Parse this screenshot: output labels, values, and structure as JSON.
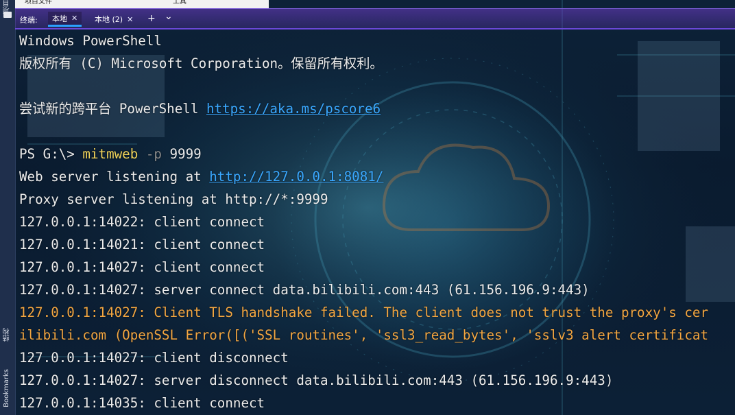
{
  "top_menu": {
    "items": [
      "项目文件",
      "工具"
    ]
  },
  "left_strip": {
    "top_label": "项目",
    "mid_label": "结构",
    "bottom_label": "Bookmarks"
  },
  "tabs": {
    "section_label": "终端:",
    "items": [
      {
        "label": "本地",
        "active": true
      },
      {
        "label": "本地 (2)",
        "active": false
      }
    ],
    "add_icon": "+",
    "dropdown_icon": "⌄"
  },
  "terminal": {
    "lines": [
      {
        "segments": [
          {
            "text": "Windows PowerShell",
            "style": "normal"
          }
        ]
      },
      {
        "segments": [
          {
            "text": "版权所有 (C) Microsoft Corporation。保留所有权利。",
            "style": "normal"
          }
        ]
      },
      {
        "segments": [
          {
            "text": "",
            "style": "normal"
          }
        ]
      },
      {
        "segments": [
          {
            "text": "尝试新的跨平台 PowerShell ",
            "style": "normal"
          },
          {
            "text": "https://aka.ms/pscore6",
            "style": "link"
          }
        ]
      },
      {
        "segments": [
          {
            "text": "",
            "style": "normal"
          }
        ]
      },
      {
        "segments": [
          {
            "text": "PS G:\\> ",
            "style": "normal"
          },
          {
            "text": "mitmweb",
            "style": "cmd"
          },
          {
            "text": " -p",
            "style": "flag"
          },
          {
            "text": " 9999",
            "style": "normal"
          }
        ]
      },
      {
        "segments": [
          {
            "text": "Web server listening at ",
            "style": "normal"
          },
          {
            "text": "http://127.0.0.1:8081/",
            "style": "link"
          }
        ]
      },
      {
        "segments": [
          {
            "text": "Proxy server listening at http://*:9999",
            "style": "normal"
          }
        ]
      },
      {
        "segments": [
          {
            "text": "127.0.0.1:14022: client connect",
            "style": "normal"
          }
        ]
      },
      {
        "segments": [
          {
            "text": "127.0.0.1:14021: client connect",
            "style": "normal"
          }
        ]
      },
      {
        "segments": [
          {
            "text": "127.0.0.1:14027: client connect",
            "style": "normal"
          }
        ]
      },
      {
        "segments": [
          {
            "text": "127.0.0.1:14027: server connect data.bilibili.com:443 (61.156.196.9:443)",
            "style": "normal"
          }
        ]
      },
      {
        "segments": [
          {
            "text": "127.0.0.1:14027: Client TLS handshake failed. The client does not trust the proxy's cer",
            "style": "warn"
          }
        ]
      },
      {
        "segments": [
          {
            "text": "ilibili.com (OpenSSL Error([('SSL routines', 'ssl3_read_bytes', 'sslv3 alert certificat",
            "style": "warn"
          }
        ]
      },
      {
        "segments": [
          {
            "text": "127.0.0.1:14027: client disconnect",
            "style": "normal"
          }
        ]
      },
      {
        "segments": [
          {
            "text": "127.0.0.1:14027: server disconnect data.bilibili.com:443 (61.156.196.9:443)",
            "style": "normal"
          }
        ]
      },
      {
        "segments": [
          {
            "text": "127.0.0.1:14035: client connect",
            "style": "normal"
          }
        ]
      }
    ]
  },
  "colors": {
    "text": "#ececec",
    "link": "#3aa8ff",
    "command": "#f0d35a",
    "flag": "#8a8a8a",
    "warning": "#f3a641",
    "tab_accent": "#2aa1ff"
  }
}
